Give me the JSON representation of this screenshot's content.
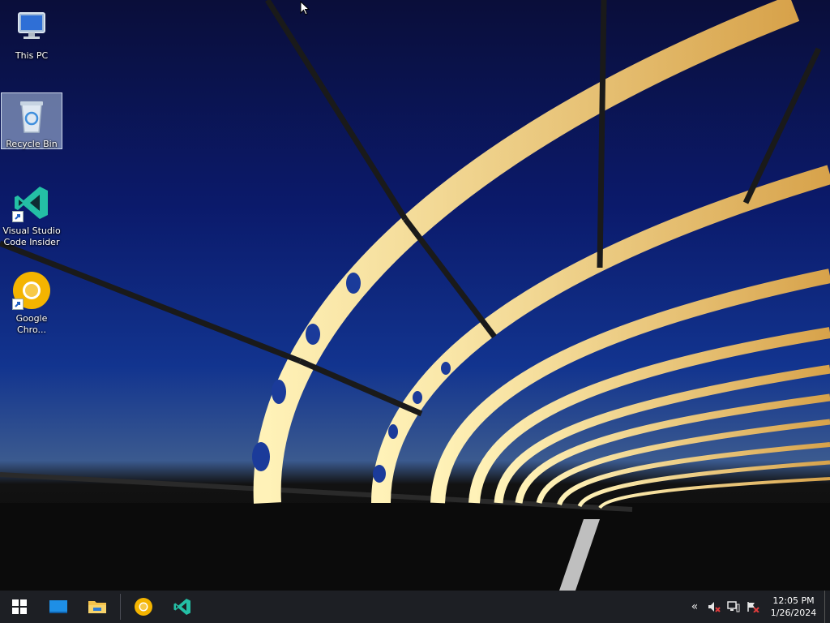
{
  "desktop": {
    "icons": [
      {
        "label": "This PC",
        "icon": "this-pc-icon"
      },
      {
        "label": "Recycle Bin",
        "icon": "recycle-bin-icon",
        "selected": true
      },
      {
        "label": "Visual Studio Code Insider",
        "icon": "vscode-insiders-icon",
        "shortcut": true
      },
      {
        "label": "Google Chro...",
        "icon": "chrome-canary-icon",
        "shortcut": true
      }
    ]
  },
  "taskbar": {
    "start": {
      "icon": "windows-start-icon"
    },
    "pinned": [
      {
        "icon": "desktop-app-icon"
      },
      {
        "icon": "file-explorer-icon"
      },
      {
        "icon": "chrome-canary-icon"
      },
      {
        "icon": "vscode-insiders-icon"
      }
    ],
    "tray": {
      "chevron": "«",
      "icons": [
        "volume-muted-icon",
        "network-icon",
        "action-center-icon"
      ]
    },
    "clock": {
      "time": "12:05 PM",
      "date": "1/26/2024"
    }
  },
  "colors": {
    "taskbar_bg": "#1d1f24",
    "vscode_insiders": "#24bfa5",
    "chrome_canary": "#f4b400",
    "explorer_folder": "#f3c24b"
  }
}
